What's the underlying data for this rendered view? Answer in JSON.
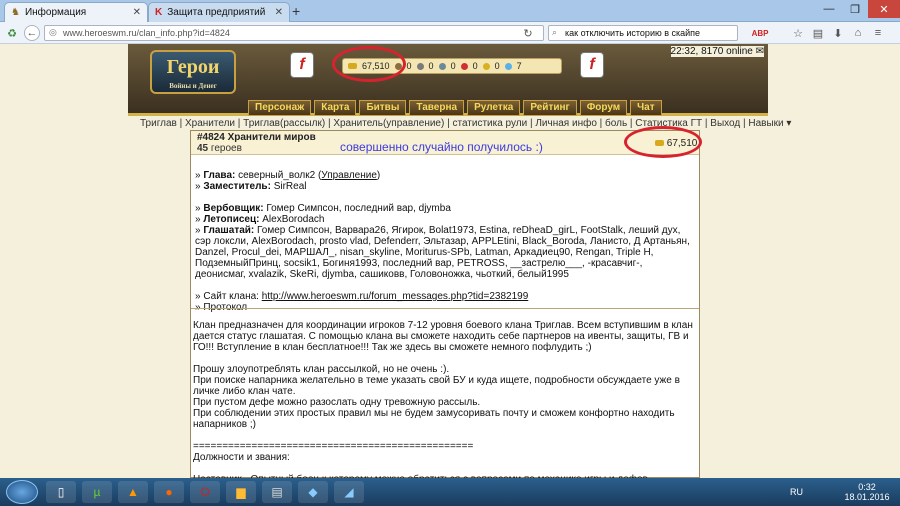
{
  "browser": {
    "tabs": [
      {
        "label": "Информация"
      },
      {
        "label": "Защита предприятий"
      }
    ],
    "url": "www.heroeswm.ru/clan_info.php?id=4824",
    "search": "как отключить историю в скайпе"
  },
  "game": {
    "logo_title": "Герои",
    "logo_sub": "Войны и Денег",
    "gold": "67,510",
    "res": [
      "0",
      "0",
      "0",
      "0",
      "0",
      "7"
    ],
    "online": "22:32, 8170 online",
    "menu": [
      "Персонаж",
      "Карта",
      "Битвы",
      "Таверна",
      "Рулетка",
      "Рейтинг",
      "Форум",
      "Чат"
    ],
    "subnav": "Триглав | Хранители | Триглав(рассылк) | Хранитель(управление) | статистика рули | Личная инфо | боль | Статистика ГТ | Выход | Навыки ▾"
  },
  "clan": {
    "name": "#4824 Хранители миров",
    "count": "45",
    "count_label": "героев",
    "annotation": "совершенно случайно получилось :)",
    "gold": "67,510",
    "head_label": "Глава:",
    "head_value": "северный_волк2",
    "head_manage": "Управление",
    "deputy_label": "Заместитель:",
    "deputy_value": "SirReal",
    "recruiter_label": "Вербовщик:",
    "recruiter_value": "Гомер Симпсон, последний вар, djymba",
    "chronicler_label": "Летописец:",
    "chronicler_value": "AlexBorodach",
    "heralds_label": "Глашатай:",
    "heralds_value": "Гомер Симпсон, Варвара26, Ягирок, Bolat1973, Estina, reDheaD_girL, FootStalk, леший дух, сэр локсли, AlexBorodach, prosto vlad, Defenderr, Эльтазар, APPLEtini, Black_Boroda, Ланисто, Д Артаньян, Danzel, Procul_dei, МАРШАЛ_, nisan_skyline, Moriturus-SPb, Latman, Аркадиец90, Rengan, Triple H, ПодземныйПринц, socsik1, Богиня1993, последний вар, PETROSS, __застрелю___, -красавчиг-, деонисмаг, xvalazik, SkeRi, djymba, сашиковв, Головоножка, чьоткий, белый1995",
    "site_label": "Сайт клана:",
    "site_url": "http://www.heroeswm.ru/forum_messages.php?tid=2382199",
    "protocol": "Протокол",
    "desc_p1": "Клан предназначен для координации игроков 7-12 уровня боевого клана Триглав. Всем вступившим в клан дается статус глашатая. С помощью клана вы сможете находить себе партнеров на ивенты, защиты, ГВ и ГО!!! Вступление в клан бесплатное!!! Так же здесь вы сможете немного пофлудить ;)",
    "desc_p2": "Прошу злоупотреблять клан рассылкой, но не очень :).",
    "desc_p3": "При поиске напарника желательно в теме указать свой БУ и куда ищете, подробности обсуждаете уже в личке либо клан чате.",
    "desc_p4": "При пустом дефе можно разослать одну тревожную рассыль.",
    "desc_p5": "При соблюдении этих простых правил мы не будем замусоривать почту и сможем конфортно находить напарников ;)",
    "divider": "================================================",
    "ranks": "Должности и звания:",
    "mentor": "Наставник - Опытный боец к которому можно обратиться с вопросами по механике игры и дефов."
  },
  "taskbar": {
    "lang": "RU",
    "time": "0:32",
    "date": "18.01.2016"
  }
}
